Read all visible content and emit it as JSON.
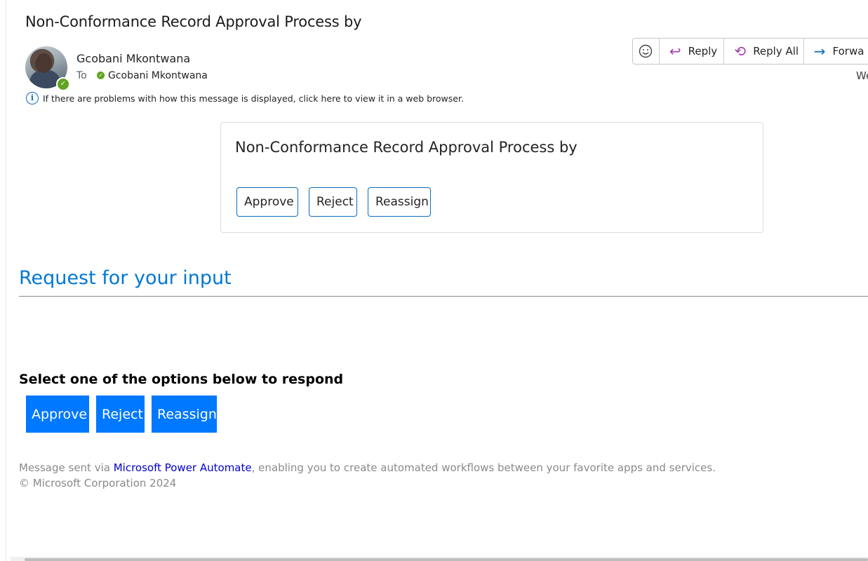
{
  "email": {
    "subject": "Non-Conformance Record Approval Process by",
    "sender": "Gcobani Mkontwana",
    "to_label": "To",
    "to_name": "Gcobani Mkontwana",
    "info_text": "If there are problems with how this message is displayed, click here to view it in a web browser.",
    "date_fragment": "We"
  },
  "actions": {
    "reply": "Reply",
    "reply_all": "Reply All",
    "forward": "Forwa"
  },
  "card": {
    "title": "Non-Conformance Record Approval Process by",
    "approve": "Approve",
    "reject": "Reject",
    "reassign": "Reassign"
  },
  "body": {
    "request_title": "Request for your input",
    "select_label": "Select one of the options below to respond",
    "approve": "Approve",
    "reject": "Reject",
    "reassign": "Reassign"
  },
  "footer": {
    "prefix": "Message sent via ",
    "link": "Microsoft Power Automate",
    "suffix": ", enabling you to create automated workflows between your favorite apps and services.",
    "copyright": "© Microsoft Corporation 2024"
  },
  "icons": {
    "emoji": "smiley-icon",
    "reply": "reply-arrow-icon",
    "reply_all": "reply-all-arrow-icon",
    "forward": "forward-arrow-icon",
    "info": "info-icon",
    "presence": "presence-available-icon"
  },
  "colors": {
    "accent": "#0078d4",
    "button_blue": "#0078ff",
    "presence_green": "#5fa31f",
    "reply_purple": "#a63fb0"
  }
}
